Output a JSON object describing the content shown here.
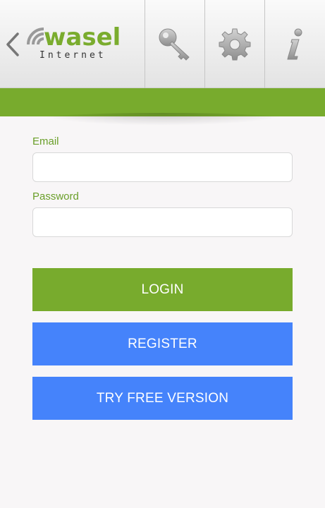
{
  "header": {
    "back_icon": "chevron-left-icon",
    "logo": {
      "word": "wasel",
      "sub": "Internet"
    },
    "tools": [
      {
        "icon": "key-icon"
      },
      {
        "icon": "gear-icon"
      },
      {
        "icon": "info-icon"
      }
    ]
  },
  "form": {
    "email_label": "Email",
    "email_value": "",
    "password_label": "Password",
    "password_value": ""
  },
  "buttons": {
    "login": "LOGIN",
    "register": "REGISTER",
    "try_free": "TRY FREE VERSION"
  },
  "colors": {
    "brand_green": "#78ab2d",
    "button_blue": "#4583fb",
    "label_green": "#6a9f29"
  }
}
